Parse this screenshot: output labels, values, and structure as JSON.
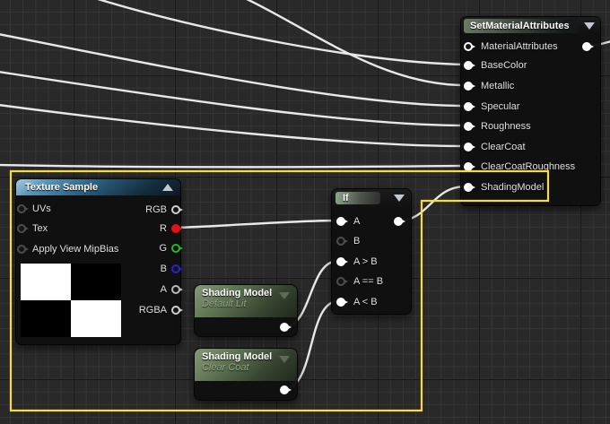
{
  "canvas": {
    "background_color": "#292929",
    "grid_minor_color": "#353535",
    "grid_major_color": "#181818",
    "wire_color": "#e8e8e8",
    "selection_color": "#f7d94c"
  },
  "nodes": {
    "sma": {
      "title": "SetMaterialAttributes",
      "pins": [
        "MaterialAttributes",
        "BaseColor",
        "Metallic",
        "Specular",
        "Roughness",
        "ClearCoat",
        "ClearCoatRoughness",
        "ShadingModel"
      ]
    },
    "texture": {
      "title": "Texture Sample",
      "inputs": [
        "UVs",
        "Tex",
        "Apply View MipBias"
      ],
      "outputs": [
        "RGB",
        "R",
        "G",
        "B",
        "A",
        "RGBA"
      ]
    },
    "if": {
      "title": "If",
      "inputs": [
        "A",
        "B",
        "A > B",
        "A == B",
        "A < B"
      ]
    },
    "shading1": {
      "title": "Shading Model",
      "subtitle": "Default Lit"
    },
    "shading2": {
      "title": "Shading Model",
      "subtitle": "Clear Coat"
    }
  },
  "pin_colors": {
    "white": "#ffffff",
    "gray_ring": "#4c4c4c",
    "light_ring": "#d0d0d0",
    "r": "#e01212",
    "g": "#2ab62a",
    "b": "#2424c8",
    "a": "#b9b9b9"
  }
}
